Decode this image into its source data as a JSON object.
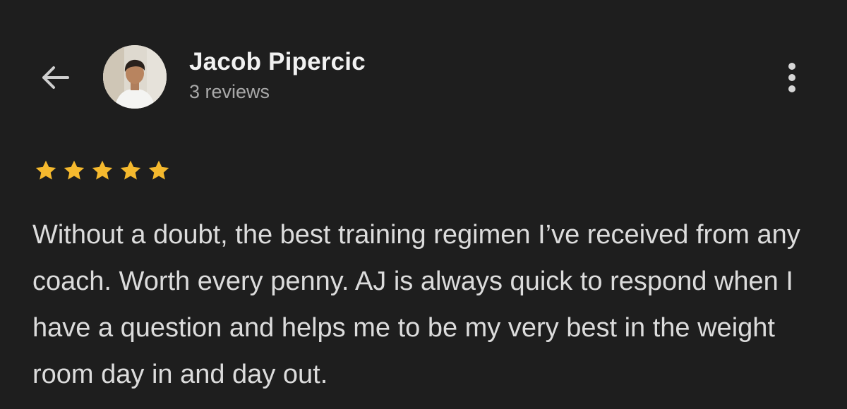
{
  "header": {
    "back_icon": "arrow-left-icon",
    "more_icon": "more-vertical-icon"
  },
  "reviewer": {
    "name": "Jacob Pipercic",
    "review_count": "3 reviews",
    "avatar_icon": "profile-photo"
  },
  "review": {
    "rating": 5,
    "max_rating": 5,
    "star_color": "#f5b92e",
    "text": "Without a doubt, the best training regimen I’ve received from any coach. Worth every penny. AJ is always quick to respond when I have a question and helps me to be my very best in the weight room day in and day out."
  },
  "colors": {
    "background": "#1e1e1e",
    "primary_text": "#f1f1f1",
    "secondary_text": "#a9a9a9",
    "star": "#f5b92e"
  }
}
